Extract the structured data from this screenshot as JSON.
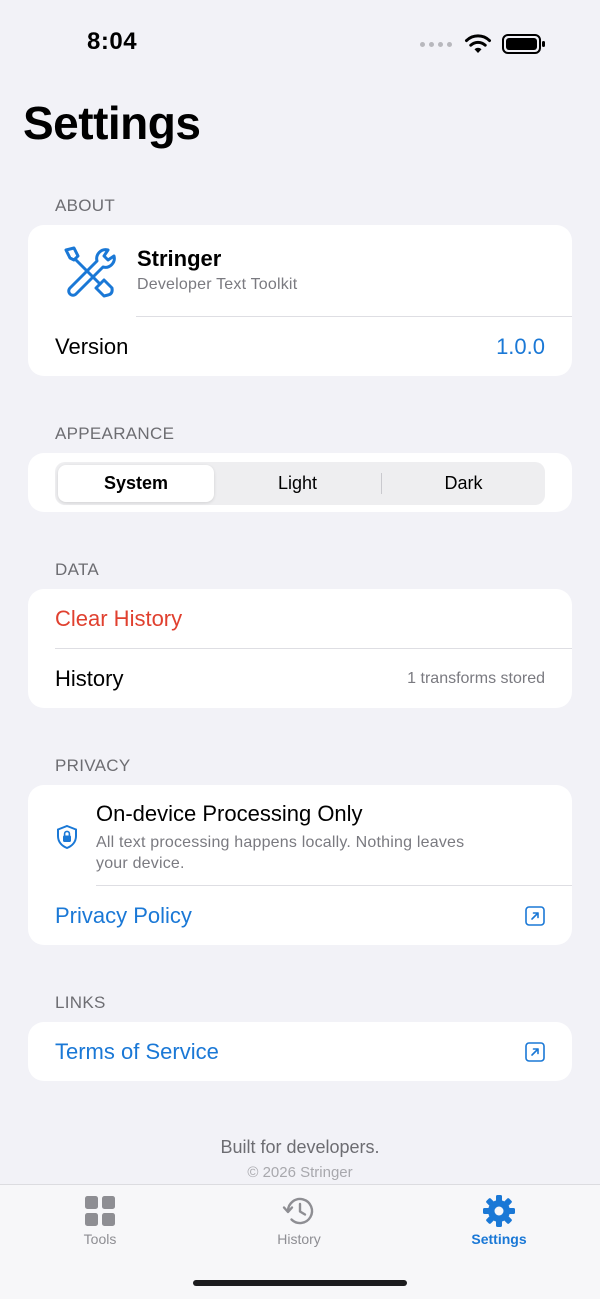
{
  "status_bar": {
    "time": "8:04"
  },
  "page_title": "Settings",
  "about": {
    "header": "ABOUT",
    "app_name": "Stringer",
    "app_subtitle": "Developer Text Toolkit",
    "version_label": "Version",
    "version_value": "1.0.0"
  },
  "appearance": {
    "header": "APPEARANCE",
    "options": [
      "System",
      "Light",
      "Dark"
    ],
    "selected": "System"
  },
  "data_section": {
    "header": "DATA",
    "clear_history": "Clear History",
    "history_label": "History",
    "history_value": "1 transforms stored"
  },
  "privacy": {
    "header": "PRIVACY",
    "title": "On-device Processing Only",
    "description_line1": "All text processing happens locally. Nothing leaves",
    "description_line2": "your device.",
    "policy_link": "Privacy Policy"
  },
  "links": {
    "header": "LINKS",
    "terms": "Terms of Service"
  },
  "footer": {
    "line1": "Built for developers.",
    "line2": "© 2026 Stringer"
  },
  "tabbar": {
    "tabs": [
      {
        "label": "Tools",
        "icon": "grid-icon",
        "active": false
      },
      {
        "label": "History",
        "icon": "history-icon",
        "active": false
      },
      {
        "label": "Settings",
        "icon": "gear-icon",
        "active": true
      }
    ]
  },
  "colors": {
    "accent": "#1a78d6",
    "destructive": "#e0402f",
    "background": "#f2f2f7",
    "tab_inactive": "#8e8e93"
  }
}
